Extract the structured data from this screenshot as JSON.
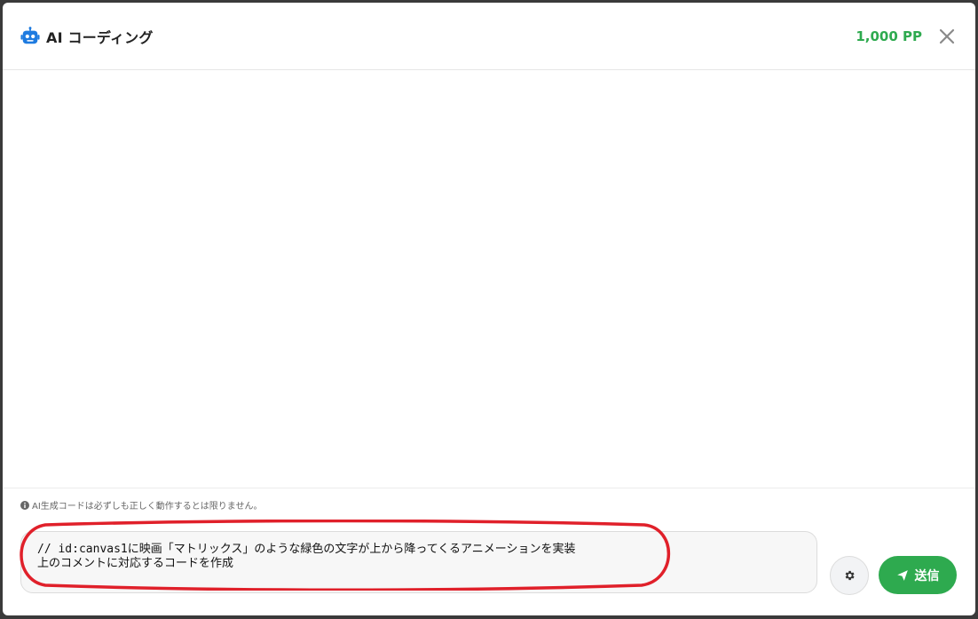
{
  "header": {
    "title": "AI コーディング",
    "points": "1,000 PP",
    "title_icon": "robot-icon",
    "close_icon": "close-icon"
  },
  "footer": {
    "disclaimer": "AI生成コードは必ずしも正しく動作するとは限りません。",
    "prompt": {
      "value": "// id:canvas1に映画「マトリックス」のような緑色の文字が上から降ってくるアニメーションを実装\n上のコメントに対応するコードを作成"
    },
    "settings_icon": "gear-icon",
    "send_label": "送信",
    "send_icon": "paper-plane-icon"
  },
  "colors": {
    "accent": "#2eaa4f",
    "robot": "#1e7be0",
    "highlight": "#e0202a"
  }
}
